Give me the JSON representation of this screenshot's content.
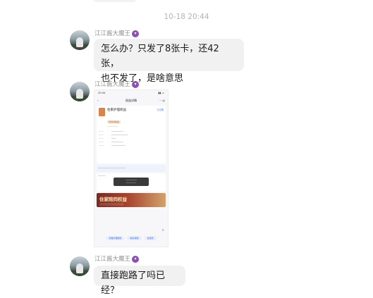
{
  "timestamp": "10-18 20:44",
  "sender": {
    "name": "江江酱大魔王",
    "emoji": "😈"
  },
  "messages": {
    "first": {
      "line1": "怎么办？只发了8张卡，还42张，",
      "line2": "也不发了，是啥意思"
    },
    "last": {
      "text": "直接跑路了吗已经？"
    }
  },
  "screenshot": {
    "status_time": "20:44",
    "title": "权益详情",
    "card": {
      "name": "住家护理权益",
      "badge": "待激活权益",
      "link": "已过期"
    },
    "banner_title": "住家陪同权益",
    "refresh": "↻",
    "buttons": [
      "查看护理服务",
      "联系客服",
      "去使用"
    ]
  },
  "icons": [
    "devil-emoji-icon",
    "avatar-photo",
    "back-arrow-icon",
    "refresh-icon"
  ],
  "colors": {
    "bubble": "#f1f1f1",
    "name": "#8e8e8e",
    "timestamp": "#b3b3b3"
  }
}
